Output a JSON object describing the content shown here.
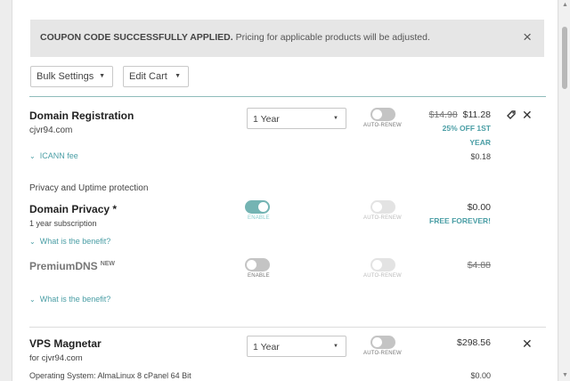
{
  "alert": {
    "bold_text": "COUPON CODE SUCCESSFULLY APPLIED.",
    "text": " Pricing for applicable products will be adjusted.",
    "close": "×"
  },
  "toolbar": {
    "bulk_settings": "Bulk Settings",
    "edit_cart": "Edit Cart"
  },
  "domain_registration": {
    "title": "Domain Registration",
    "domain": "cjvr94.com",
    "term": "1 Year",
    "auto_renew_label": "AUTO-RENEW",
    "old_price": "$14.98",
    "new_price": "$11.28",
    "promo_line1": "25% OFF 1ST",
    "promo_line2": "YEAR",
    "icann_label": "ICANN fee",
    "icann_price": "$0.18"
  },
  "privacy_section": {
    "title": "Privacy and Uptime protection"
  },
  "domain_privacy": {
    "title": "Domain Privacy *",
    "subscription": "1 year subscription",
    "enable_label": "ENABLE",
    "auto_renew_label": "AUTO-RENEW",
    "price": "$0.00",
    "promo": "FREE FOREVER!",
    "benefit_link": "What is the benefit?"
  },
  "premium_dns": {
    "title": "PremiumDNS",
    "badge": "NEW",
    "enable_label": "ENABLE",
    "auto_renew_label": "AUTO-RENEW",
    "price": "$4.88",
    "benefit_link": "What is the benefit?"
  },
  "vps": {
    "title": "VPS Magnetar",
    "for": "for cjvr94.com",
    "term": "1 Year",
    "auto_renew_label": "AUTO-RENEW",
    "price": "$298.56",
    "os_line": "Operating System: AlmaLinux 8 cPanel 64 Bit",
    "os_price": "$0.00"
  },
  "icons": {
    "close": "close-icon",
    "tag": "tag-icon",
    "chevron": "chevron-down-icon"
  }
}
